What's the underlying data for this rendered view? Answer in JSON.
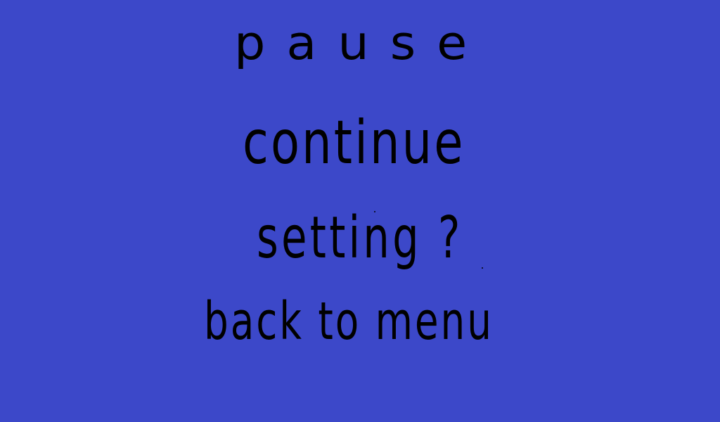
{
  "screen": {
    "background_color": "#3c48c9",
    "text_color": "#000000"
  },
  "pause_menu": {
    "title": "pause",
    "items": [
      {
        "label": "continue"
      },
      {
        "label": "setting ?"
      },
      {
        "label": "back to menu"
      }
    ]
  }
}
